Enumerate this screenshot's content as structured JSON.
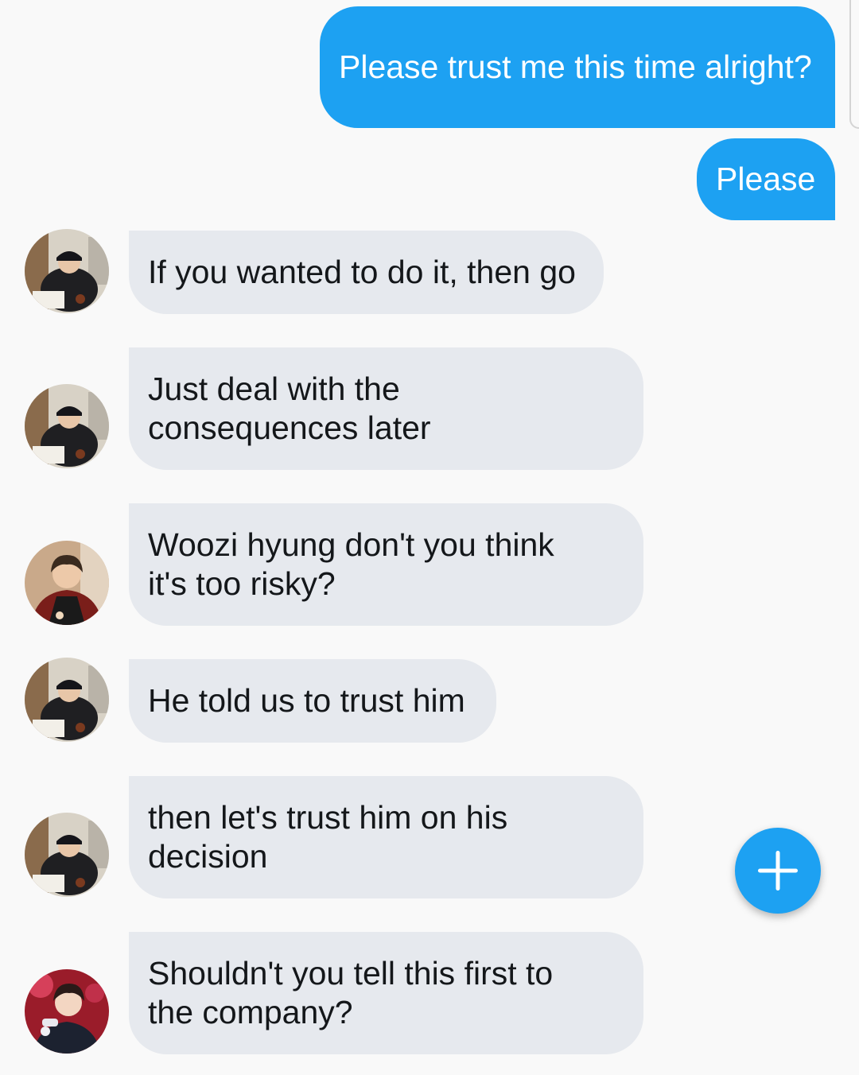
{
  "messages": [
    {
      "sender": "me",
      "text": "Please trust me this time alright?"
    },
    {
      "sender": "me",
      "text": "Please"
    },
    {
      "sender": "user-a",
      "text": "If you wanted to do it, then go"
    },
    {
      "sender": "user-a",
      "text": "Just deal with the consequences later"
    },
    {
      "sender": "user-b",
      "text": "Woozi hyung don't you think it's too risky?"
    },
    {
      "sender": "user-a",
      "text": "He told us to trust him"
    },
    {
      "sender": "user-a",
      "text": "then let's trust him on his decision"
    },
    {
      "sender": "user-c",
      "text": "Shouldn't you tell this first to the company?"
    }
  ],
  "fab": {
    "icon": "plus-icon"
  },
  "colors": {
    "background": "#f9f9f9",
    "sent_bubble": "#1da1f2",
    "received_bubble": "#e6e9ee",
    "received_text": "#14171a",
    "fab": "#1da1f2"
  }
}
